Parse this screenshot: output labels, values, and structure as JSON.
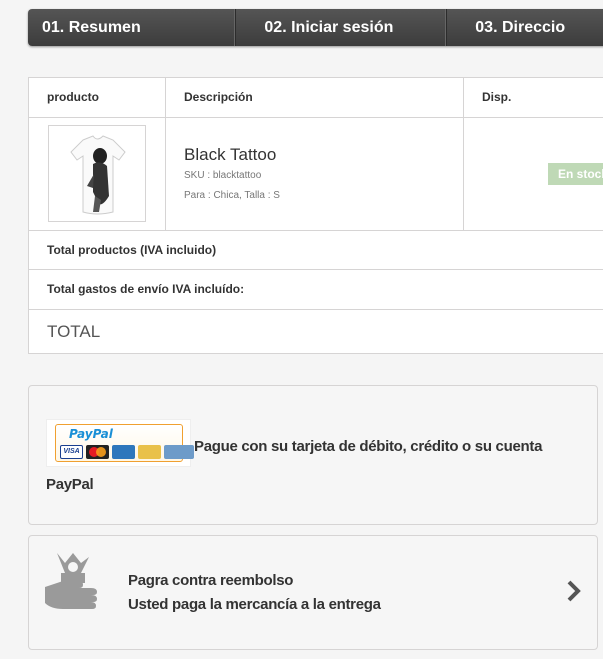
{
  "steps": [
    "01. Resumen",
    "02. Iniciar sesión",
    "03. Direccio"
  ],
  "table": {
    "headers": {
      "product": "producto",
      "description": "Descripción",
      "availability": "Disp."
    },
    "item": {
      "name": "Black Tattoo",
      "sku": "SKU : blacktattoo",
      "attributes": "Para : Chica, Talla : S",
      "stock_label": "En stock"
    },
    "totals": {
      "products": "Total productos (IVA incluido)",
      "shipping": "Total gastos de envío IVA incluído:",
      "total": "TOTAL"
    }
  },
  "payment": {
    "paypal_logo_text": "PayPal",
    "paypal_text": "Pague con su tarjeta de débito, crédito o su cuenta PayPal",
    "cod_line1": "Pagra contra reembolso",
    "cod_line2": "Usted paga la mercancía a la entrega"
  },
  "colors": {
    "steps_bg": "#3c3c3c",
    "stock_badge": "#bfd9b6",
    "border": "#d6d4d4"
  },
  "icons": {
    "cod": "hand-money-icon",
    "arrow": "chevron-right-icon"
  }
}
